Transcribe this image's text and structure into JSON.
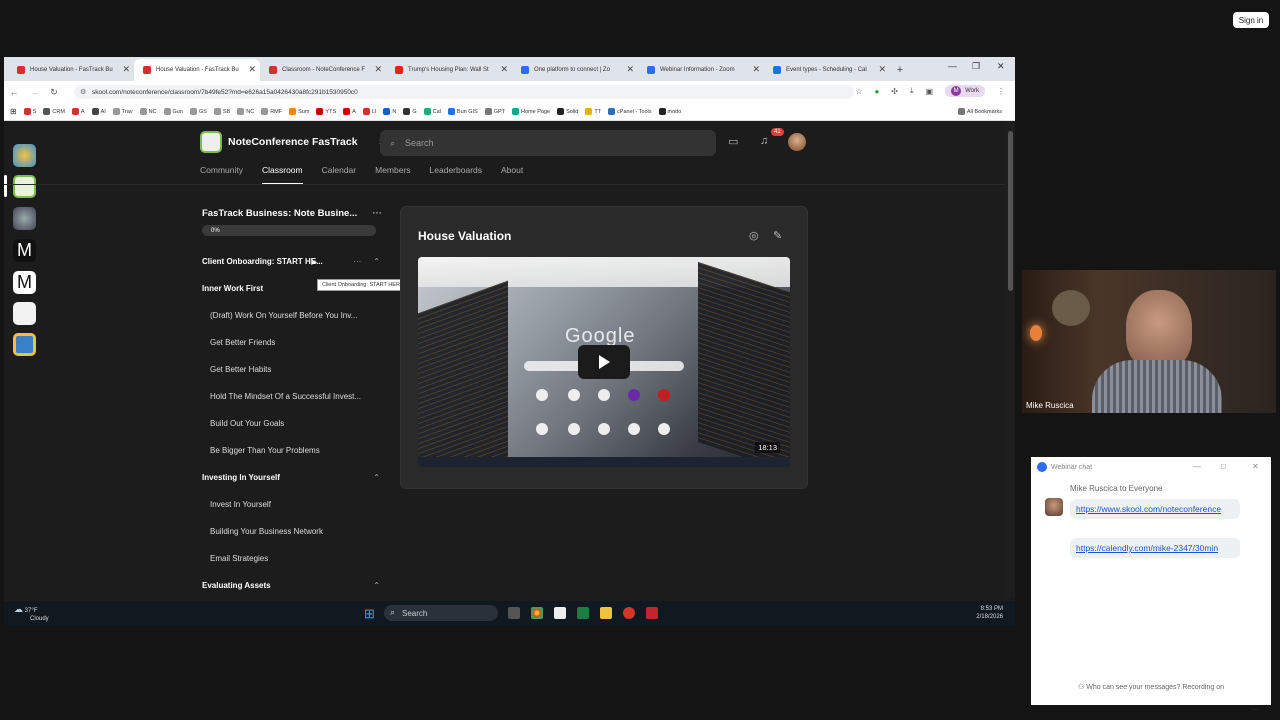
{
  "zoom": {
    "sign_in": "Sign in"
  },
  "browser": {
    "tabs": [
      {
        "label": "House Valuation - FasTrack Bu",
        "active": false,
        "color": "#d62e2e"
      },
      {
        "label": "House Valuation - FasTrack Bu",
        "active": true,
        "color": "#d62e2e"
      },
      {
        "label": "Classroom - NoteConference F",
        "active": false,
        "color": "#d62e2e"
      },
      {
        "label": "Trump's Housing Plan: Wall St",
        "active": false,
        "color": "#e62117"
      },
      {
        "label": "One platform to connect | Zo",
        "active": false,
        "color": "#2d6cf0"
      },
      {
        "label": "Webinar Information - Zoom",
        "active": false,
        "color": "#2d6cf0"
      },
      {
        "label": "Event types - Scheduling - Cal",
        "active": false,
        "color": "#1a73e8"
      }
    ],
    "url": "skool.com/noteconference/classroom/7b49fe52?md=e626a15a0426430a8fc291b1530950c0",
    "profile": "Work",
    "bookmarks": [
      "S",
      "CRM",
      "A",
      "AI",
      "Trav",
      "NC",
      "Gun",
      "GS",
      "SB",
      "NC",
      "RMF",
      "Sum",
      "YTS",
      "A",
      "LI",
      "N",
      "G",
      "Cal",
      "Bun GIS",
      "GPT",
      "Home Page",
      "Solid",
      "TT",
      "cPanel - Tools",
      "modo"
    ],
    "all_bookmarks": "All Bookmarks"
  },
  "app": {
    "brand": "NoteConference FasTrack",
    "search_placeholder": "Search",
    "notif_count": "41",
    "nav": [
      "Community",
      "Classroom",
      "Calendar",
      "Members",
      "Leaderboards",
      "About"
    ],
    "active_nav": "Classroom",
    "course_title": "FasTrack Business: Note Busine...",
    "progress": "0%",
    "tooltip": "Client Onboarding: START HERE",
    "sections": [
      {
        "title": "Client Onboarding: START HE...",
        "lessons": []
      },
      {
        "title": "Inner Work First",
        "lessons": [
          "(Draft) Work On Yourself Before You Inv...",
          "Get Better Friends",
          "Get Better Habits",
          "Hold The Mindset Of a Successful Invest...",
          "Build Out Your Goals",
          "Be Bigger Than Your Problems"
        ]
      },
      {
        "title": "Investing In Yourself",
        "lessons": [
          "Invest In Yourself",
          "Building Your Business Network",
          "Email Strategies"
        ]
      },
      {
        "title": "Evaluating Assets",
        "lessons": []
      }
    ],
    "lesson_title": "House Valuation",
    "video_duration": "18:13",
    "video_google": "Google"
  },
  "taskbar": {
    "weather_temp": "37°F",
    "weather_desc": "Cloudy",
    "search": "Search",
    "time": "8:53 PM",
    "date": "2/18/2026"
  },
  "webcam": {
    "name": "Mike Ruscica"
  },
  "chat": {
    "title": "Webinar chat",
    "from": "Mike Ruscica to Everyone",
    "messages": [
      "https://www.skool.com/noteconference",
      "https://calendly.com/mike-2347/30min"
    ],
    "footer": "Who can see your messages? Recording on",
    "more": "..."
  }
}
